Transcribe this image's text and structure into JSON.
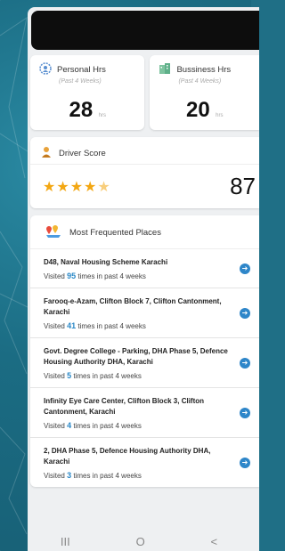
{
  "personal": {
    "title": "Personal Hrs",
    "sub": "(Past 4 Weeks)",
    "value": "28",
    "unit": "hrs"
  },
  "business": {
    "title": "Bussiness Hrs",
    "sub": "(Past 4 Weeks)",
    "value": "20",
    "unit": "hrs"
  },
  "driver": {
    "title": "Driver Score",
    "stars": "★★★★",
    "half": "★",
    "score": "87"
  },
  "places": {
    "title": "Most Frequented Places",
    "items": [
      {
        "name": "D48, Naval Housing Scheme Karachi",
        "pre": "Visited",
        "count": "95",
        "post": "times in past 4 weeks"
      },
      {
        "name": "Farooq-e-Azam, Clifton Block 7, Clifton Cantonment, Karachi",
        "pre": "Visited",
        "count": "41",
        "post": "times in past 4 weeks"
      },
      {
        "name": "Govt. Degree College - Parking, DHA Phase 5, Defence Housing Authority DHA, Karachi",
        "pre": "Visited",
        "count": "5",
        "post": "times in past 4 weeks"
      },
      {
        "name": "Infinity Eye Care Center, Clifton Block 3, Clifton Cantonment, Karachi",
        "pre": "Visited",
        "count": "4",
        "post": "times in past 4 weeks"
      },
      {
        "name": "2, DHA Phase 5, Defence Housing Authority DHA, Karachi",
        "pre": "Visited",
        "count": "3",
        "post": "times in past 4 weeks"
      }
    ]
  },
  "nav": {
    "recents": "III",
    "home": "O",
    "back": "<"
  },
  "colors": {
    "accent": "#2e86c9",
    "star": "#f3a712",
    "background": "#1f6f86"
  },
  "icons": {
    "personal": "person-gear-icon",
    "business": "building-icon",
    "driver": "driver-icon",
    "places": "map-pins-icon",
    "arrow": "arrow-right-circle-icon"
  }
}
